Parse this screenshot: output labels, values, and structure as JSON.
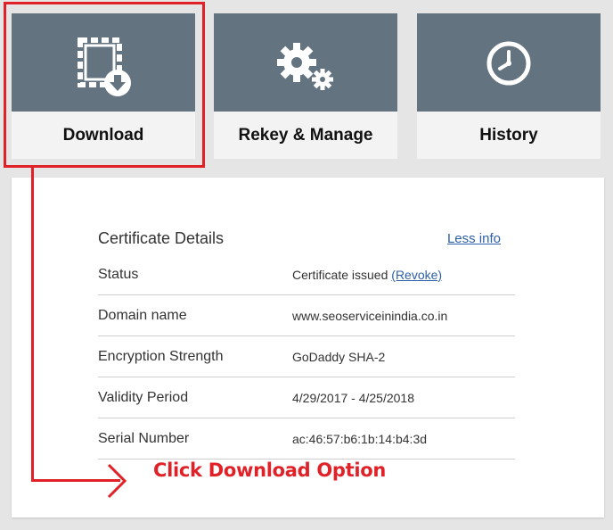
{
  "tiles": [
    {
      "label": "Download",
      "icon": "certificate-download-icon"
    },
    {
      "label": "Rekey & Manage",
      "icon": "gears-icon"
    },
    {
      "label": "History",
      "icon": "clock-icon"
    }
  ],
  "details": {
    "title": "Certificate Details",
    "less_info": "Less info",
    "rows": [
      {
        "label": "Status",
        "value": "Certificate issued",
        "action": "(Revoke)"
      },
      {
        "label": "Domain name",
        "value": "www.seoserviceinindia.co.in"
      },
      {
        "label": "Encryption Strength",
        "value": "GoDaddy SHA-2"
      },
      {
        "label": "Validity Period",
        "value": "4/29/2017 - 4/25/2018"
      },
      {
        "label": "Serial Number",
        "value": "ac:46:57:b6:1b:14:b4:3d"
      }
    ]
  },
  "annotation": {
    "text": "Click Download Option",
    "color": "#e02228"
  },
  "colors": {
    "tile_header": "#637380",
    "tile_body": "#f3f3f3",
    "link": "#2d5fa6"
  }
}
